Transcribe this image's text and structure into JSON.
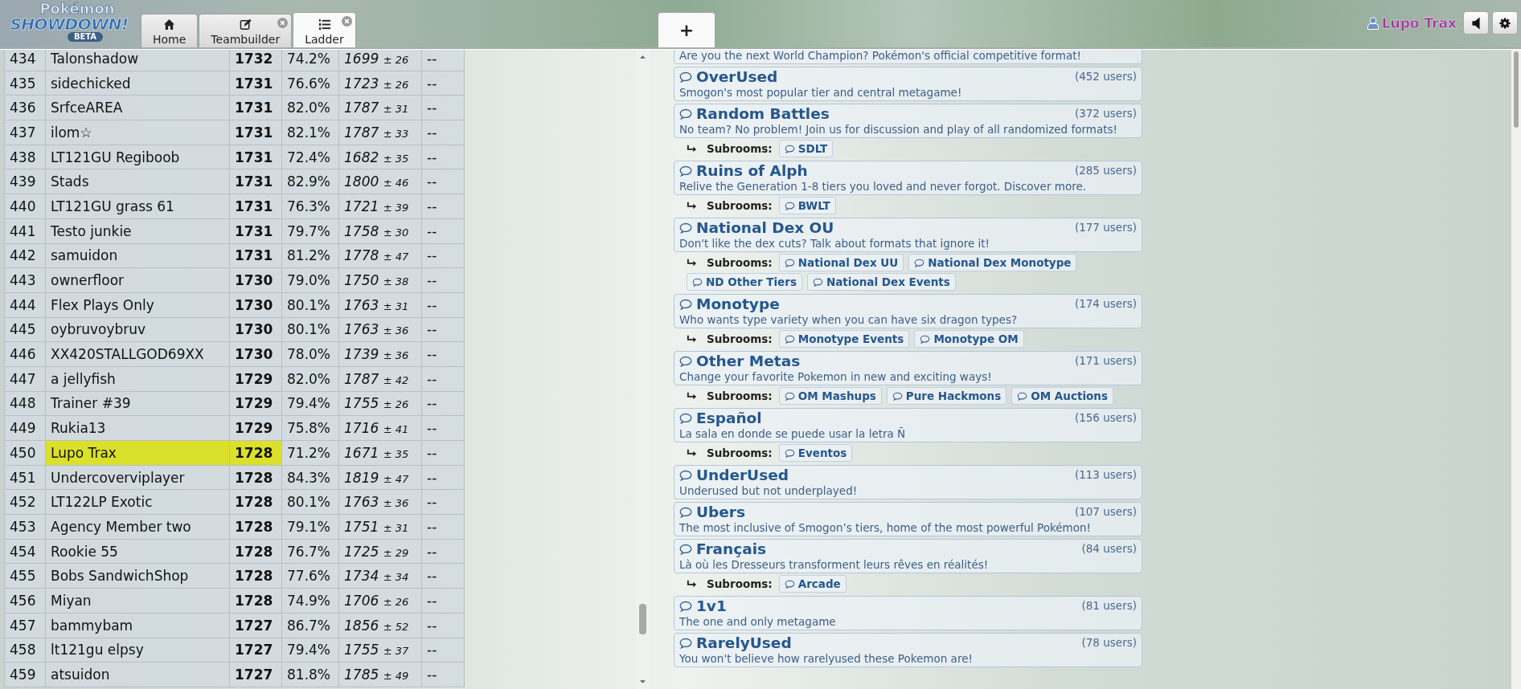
{
  "logo": {
    "top": "Pokémon",
    "main": "SHOWDOWN!",
    "badge": "BETA"
  },
  "tabs": [
    {
      "label": "Home",
      "selected": false,
      "closable": false
    },
    {
      "label": "Teambuilder",
      "selected": false,
      "closable": true
    },
    {
      "label": "Ladder",
      "selected": true,
      "closable": true
    }
  ],
  "new_tab": "+",
  "user": {
    "name": "Lupo Trax"
  },
  "ladder": {
    "rows": [
      {
        "rank": "434",
        "name": "Talonshadow",
        "elo": "1732",
        "gxe": "74.2%",
        "glicko": "1699",
        "deviation": "± 26",
        "coil": "--",
        "highlighted": false
      },
      {
        "rank": "435",
        "name": "sidechicked",
        "elo": "1731",
        "gxe": "76.6%",
        "glicko": "1723",
        "deviation": "± 26",
        "coil": "--",
        "highlighted": false
      },
      {
        "rank": "436",
        "name": "SrfceAREA",
        "elo": "1731",
        "gxe": "82.0%",
        "glicko": "1787",
        "deviation": "± 31",
        "coil": "--",
        "highlighted": false
      },
      {
        "rank": "437",
        "name": "ilom☆",
        "elo": "1731",
        "gxe": "82.1%",
        "glicko": "1787",
        "deviation": "± 33",
        "coil": "--",
        "highlighted": false
      },
      {
        "rank": "438",
        "name": "LT121GU Regiboob",
        "elo": "1731",
        "gxe": "72.4%",
        "glicko": "1682",
        "deviation": "± 35",
        "coil": "--",
        "highlighted": false
      },
      {
        "rank": "439",
        "name": "Stads",
        "elo": "1731",
        "gxe": "82.9%",
        "glicko": "1800",
        "deviation": "± 46",
        "coil": "--",
        "highlighted": false
      },
      {
        "rank": "440",
        "name": "LT121GU grass 61",
        "elo": "1731",
        "gxe": "76.3%",
        "glicko": "1721",
        "deviation": "± 39",
        "coil": "--",
        "highlighted": false
      },
      {
        "rank": "441",
        "name": "Testo junkie",
        "elo": "1731",
        "gxe": "79.7%",
        "glicko": "1758",
        "deviation": "± 30",
        "coil": "--",
        "highlighted": false
      },
      {
        "rank": "442",
        "name": "samuidon",
        "elo": "1731",
        "gxe": "81.2%",
        "glicko": "1778",
        "deviation": "± 47",
        "coil": "--",
        "highlighted": false
      },
      {
        "rank": "443",
        "name": "ownerfloor",
        "elo": "1730",
        "gxe": "79.0%",
        "glicko": "1750",
        "deviation": "± 38",
        "coil": "--",
        "highlighted": false
      },
      {
        "rank": "444",
        "name": "Flex Plays Only",
        "elo": "1730",
        "gxe": "80.1%",
        "glicko": "1763",
        "deviation": "± 31",
        "coil": "--",
        "highlighted": false
      },
      {
        "rank": "445",
        "name": "oybruvoybruv",
        "elo": "1730",
        "gxe": "80.1%",
        "glicko": "1763",
        "deviation": "± 36",
        "coil": "--",
        "highlighted": false
      },
      {
        "rank": "446",
        "name": "XX420STALLGOD69XX",
        "elo": "1730",
        "gxe": "78.0%",
        "glicko": "1739",
        "deviation": "± 36",
        "coil": "--",
        "highlighted": false
      },
      {
        "rank": "447",
        "name": "a jellyfish",
        "elo": "1729",
        "gxe": "82.0%",
        "glicko": "1787",
        "deviation": "± 42",
        "coil": "--",
        "highlighted": false
      },
      {
        "rank": "448",
        "name": "Trainer #39",
        "elo": "1729",
        "gxe": "79.4%",
        "glicko": "1755",
        "deviation": "± 26",
        "coil": "--",
        "highlighted": false
      },
      {
        "rank": "449",
        "name": "Rukia13",
        "elo": "1729",
        "gxe": "75.8%",
        "glicko": "1716",
        "deviation": "± 41",
        "coil": "--",
        "highlighted": false
      },
      {
        "rank": "450",
        "name": "Lupo Trax",
        "elo": "1728",
        "gxe": "71.2%",
        "glicko": "1671",
        "deviation": "± 35",
        "coil": "--",
        "highlighted": true
      },
      {
        "rank": "451",
        "name": "Undercoverviplayer",
        "elo": "1728",
        "gxe": "84.3%",
        "glicko": "1819",
        "deviation": "± 47",
        "coil": "--",
        "highlighted": false
      },
      {
        "rank": "452",
        "name": "LT122LP Exotic",
        "elo": "1728",
        "gxe": "80.1%",
        "glicko": "1763",
        "deviation": "± 36",
        "coil": "--",
        "highlighted": false
      },
      {
        "rank": "453",
        "name": "Agency Member two",
        "elo": "1728",
        "gxe": "79.1%",
        "glicko": "1751",
        "deviation": "± 31",
        "coil": "--",
        "highlighted": false
      },
      {
        "rank": "454",
        "name": "Rookie 55",
        "elo": "1728",
        "gxe": "76.7%",
        "glicko": "1725",
        "deviation": "± 29",
        "coil": "--",
        "highlighted": false
      },
      {
        "rank": "455",
        "name": "Bobs SandwichShop",
        "elo": "1728",
        "gxe": "77.6%",
        "glicko": "1734",
        "deviation": "± 34",
        "coil": "--",
        "highlighted": false
      },
      {
        "rank": "456",
        "name": "Miyan",
        "elo": "1728",
        "gxe": "74.9%",
        "glicko": "1706",
        "deviation": "± 26",
        "coil": "--",
        "highlighted": false
      },
      {
        "rank": "457",
        "name": "bammybam",
        "elo": "1727",
        "gxe": "86.7%",
        "glicko": "1856",
        "deviation": "± 52",
        "coil": "--",
        "highlighted": false
      },
      {
        "rank": "458",
        "name": "lt121gu elpsy",
        "elo": "1727",
        "gxe": "79.4%",
        "glicko": "1755",
        "deviation": "± 37",
        "coil": "--",
        "highlighted": false
      },
      {
        "rank": "459",
        "name": "atsuidon",
        "elo": "1727",
        "gxe": "81.8%",
        "glicko": "1785",
        "deviation": "± 49",
        "coil": "--",
        "highlighted": false
      }
    ]
  },
  "rooms": [
    {
      "description": "Are you the next World Champion? Pokémon's official competitive format!"
    },
    {
      "title": "OverUsed",
      "users": "(452 users)",
      "description": "Smogon's most popular tier and central metagame!"
    },
    {
      "title": "Random Battles",
      "users": "(372 users)",
      "description": "No team? No problem! Join us for discussion and play of all randomized formats!",
      "subrooms_label": "Subrooms:",
      "subrooms": [
        "SDLT"
      ]
    },
    {
      "title": "Ruins of Alph",
      "users": "(285 users)",
      "description": "Relive the Generation 1-8 tiers you loved and never forgot. Discover more.",
      "subrooms_label": "Subrooms:",
      "subrooms": [
        "BWLT"
      ]
    },
    {
      "title": "National Dex OU",
      "users": "(177 users)",
      "description": "Don't like the dex cuts? Talk about formats that ignore it!",
      "subrooms_label": "Subrooms:",
      "subrooms": [
        "National Dex UU",
        "National Dex Monotype",
        "ND Other Tiers",
        "National Dex Events"
      ]
    },
    {
      "title": "Monotype",
      "users": "(174 users)",
      "description": "Who wants type variety when you can have six dragon types?",
      "subrooms_label": "Subrooms:",
      "subrooms": [
        "Monotype Events",
        "Monotype OM"
      ]
    },
    {
      "title": "Other Metas",
      "users": "(171 users)",
      "description": "Change your favorite Pokemon in new and exciting ways!",
      "subrooms_label": "Subrooms:",
      "subrooms": [
        "OM Mashups",
        "Pure Hackmons",
        "OM Auctions"
      ]
    },
    {
      "title": "Español",
      "users": "(156 users)",
      "description": "La sala en donde se puede usar la letra Ñ",
      "subrooms_label": "Subrooms:",
      "subrooms": [
        "Eventos"
      ]
    },
    {
      "title": "UnderUsed",
      "users": "(113 users)",
      "description": "Underused but not underplayed!"
    },
    {
      "title": "Ubers",
      "users": "(107 users)",
      "description": "The most inclusive of Smogon’s tiers, home of the most powerful Pokémon!"
    },
    {
      "title": "Français",
      "users": "(84 users)",
      "description": "Là où les Dresseurs transforment leurs rêves en réalités!",
      "subrooms_label": "Subrooms:",
      "subrooms": [
        "Arcade"
      ]
    },
    {
      "title": "1v1",
      "users": "(81 users)",
      "description": "The one and only metagame"
    },
    {
      "title": "RarelyUsed",
      "users": "(78 users)",
      "description": "You won't believe how rarelyused these Pokemon are!"
    }
  ]
}
